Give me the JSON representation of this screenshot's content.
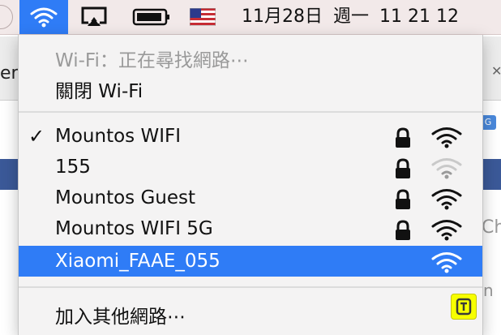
{
  "menubar": {
    "clock": {
      "date": "11月28日",
      "weekday": "週一",
      "time": "11 21 12"
    }
  },
  "wifi_menu": {
    "status_text": "Wi-Fi：正在尋找網路⋯",
    "toggle_label": "關閉 Wi-Fi",
    "networks": [
      {
        "name": "Mountos WIFI",
        "connected": true,
        "secured": true,
        "signal_bars": 3,
        "signal_strength": "full"
      },
      {
        "name": "155",
        "connected": false,
        "secured": true,
        "signal_bars": 3,
        "signal_strength": "weak"
      },
      {
        "name": "Mountos Guest",
        "connected": false,
        "secured": true,
        "signal_bars": 3,
        "signal_strength": "full"
      },
      {
        "name": "Mountos WIFI 5G",
        "connected": false,
        "secured": true,
        "signal_bars": 3,
        "signal_strength": "full"
      },
      {
        "name": "Xiaomi_FAAE_055",
        "connected": false,
        "secured": false,
        "signal_bars": 3,
        "signal_strength": "full",
        "highlighted": true
      }
    ],
    "other_networks_label": "加入其他網路⋯"
  },
  "background": {
    "tab_text_fragment": "er",
    "gray_text_fragment_1": "Ch",
    "gray_text_fragment_2": "n",
    "badge_text": "G"
  },
  "colors": {
    "menubar_bg": "#f2e9e9",
    "accent_blue": "#2f7cf6",
    "menu_bg": "#f4f3f3",
    "disabled_text": "#9a9a9a"
  },
  "icons": {
    "menubar": [
      "wifi-icon",
      "airplay-icon",
      "battery-icon",
      "us-flag-icon"
    ],
    "network_row": [
      "checkmark-icon",
      "lock-icon",
      "wifi-signal-icon"
    ]
  }
}
